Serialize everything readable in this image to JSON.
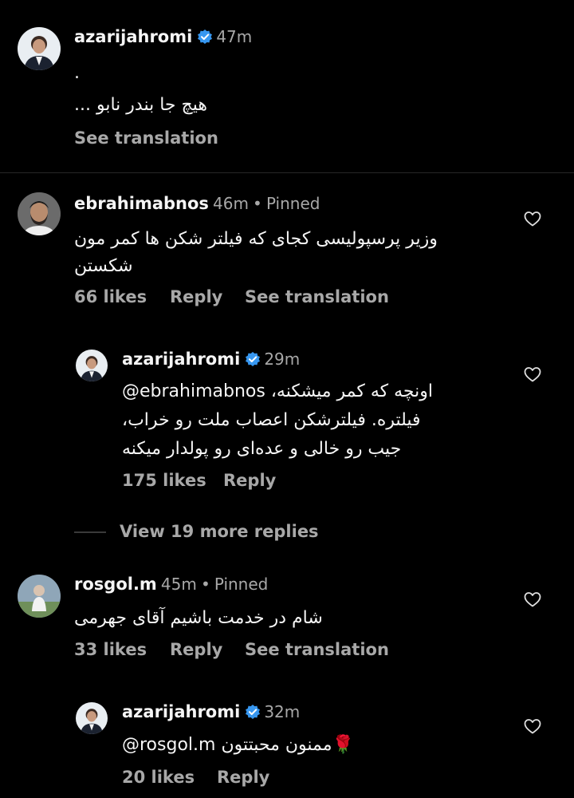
{
  "colors": {
    "background": "#000000",
    "text_primary": "#f5f5f5",
    "text_secondary": "#a8a8a8",
    "verified_blue": "#3797f0"
  },
  "post": {
    "username": "azarijahromi",
    "time": "47m",
    "line1": ".",
    "line2": "هیچ جا بندر نابو ...",
    "see_translation": "See translation"
  },
  "comments": [
    {
      "username": "ebrahimabnos",
      "time": "46m",
      "pinned": "Pinned",
      "text_line1": "وزیر پرسپولیسی کجای که فیلتر شکن ها کمر مون",
      "text_line2": "شکستن",
      "likes": "66 likes",
      "reply": "Reply",
      "see_translation": "See translation",
      "reply_item": {
        "username": "azarijahromi",
        "time": "29m",
        "text_line1": "اونچه که کمر میشکنه، ‪@ebrahimabnos‬",
        "text_line2": "فیلتره. فیلترشکن اعصاب ملت رو خراب،",
        "text_line3": "جیب رو خالی و عده‌ای رو پولدار میکنه",
        "likes": "175 likes",
        "reply": "Reply"
      },
      "view_more": "View 19 more replies"
    },
    {
      "username": "rosgol.m",
      "time": "45m",
      "pinned": "Pinned",
      "text_line1": "شام در خدمت باشیم آقای جهرمی",
      "likes": "33 likes",
      "reply": "Reply",
      "see_translation": "See translation",
      "reply_item": {
        "username": "azarijahromi",
        "time": "32m",
        "text_line1": "🌹ممنون محبتتون ‪@rosgol.m‬",
        "likes": "20 likes",
        "reply": "Reply"
      }
    }
  ]
}
